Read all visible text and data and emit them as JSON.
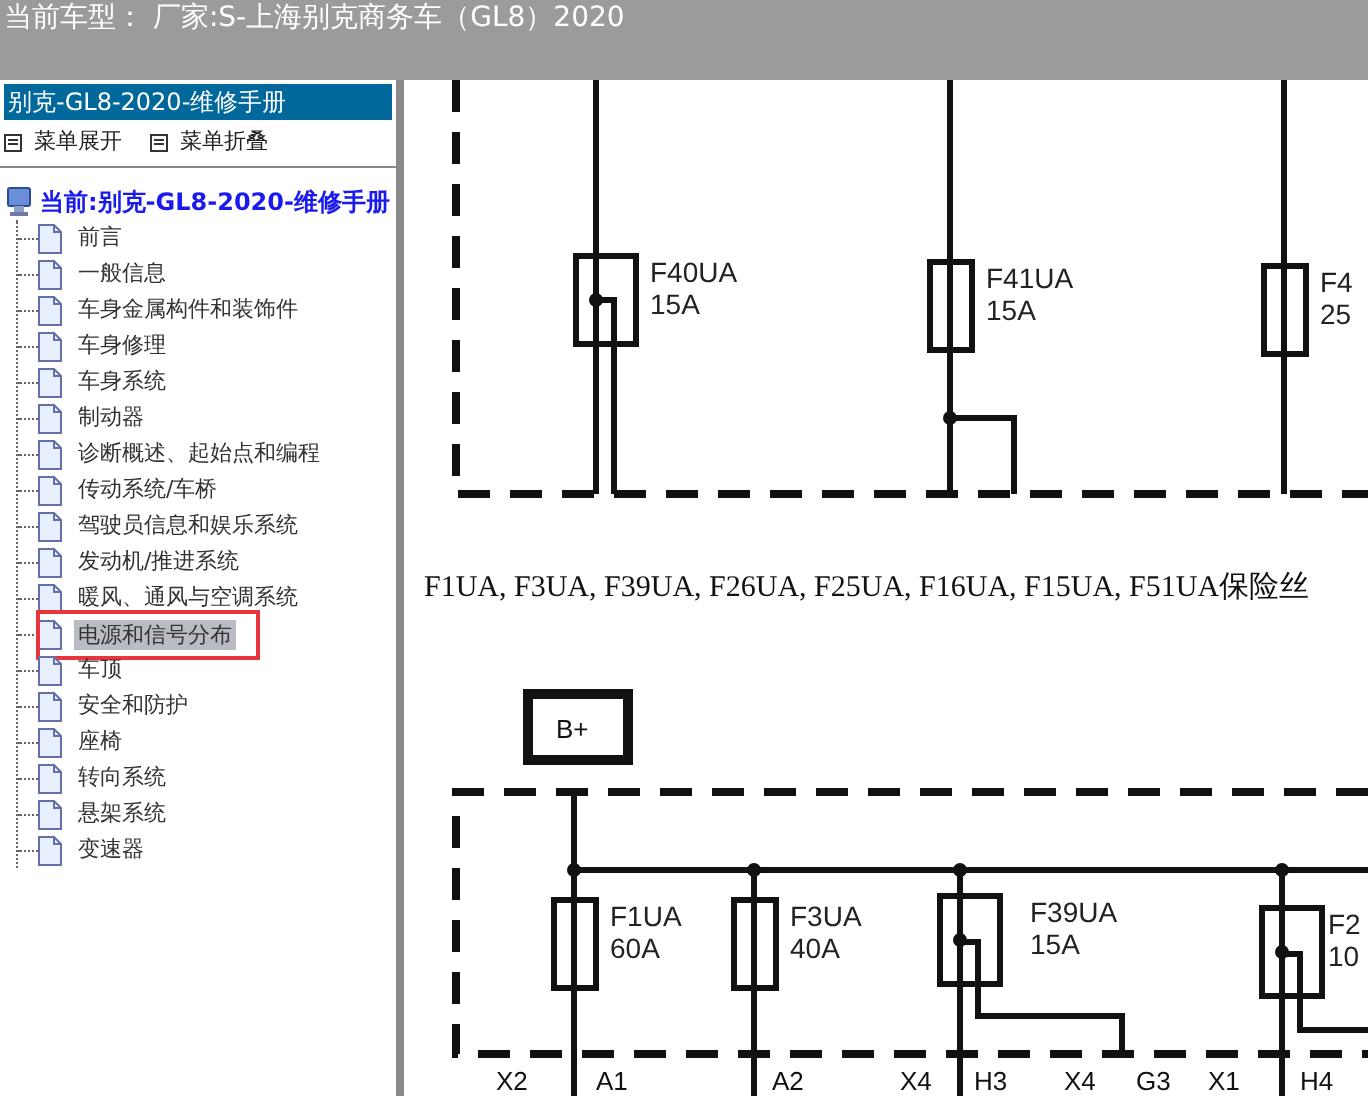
{
  "title_bar": {
    "text": "当前车型： 厂家:S-上海别克商务车（GL8）2020"
  },
  "sidebar": {
    "header": "别克-GL8-2020-维修手册",
    "actions": [
      {
        "label": "菜单展开"
      },
      {
        "label": "菜单折叠"
      }
    ],
    "tree": {
      "label": "当前:别克-GL8-2020-维修手册",
      "children": [
        {
          "label": "前言",
          "selected": false
        },
        {
          "label": "一般信息",
          "selected": false
        },
        {
          "label": "车身金属构件和装饰件",
          "selected": false
        },
        {
          "label": "车身修理",
          "selected": false
        },
        {
          "label": "车身系统",
          "selected": false
        },
        {
          "label": "制动器",
          "selected": false
        },
        {
          "label": "诊断概述、起始点和编程",
          "selected": false
        },
        {
          "label": "传动系统/车桥",
          "selected": false
        },
        {
          "label": "驾驶员信息和娱乐系统",
          "selected": false
        },
        {
          "label": "发动机/推进系统",
          "selected": false
        },
        {
          "label": "暖风、通风与空调系统",
          "selected": false
        },
        {
          "label": "电源和信号分布",
          "selected": true
        },
        {
          "label": "车顶",
          "selected": false
        },
        {
          "label": "安全和防护",
          "selected": false
        },
        {
          "label": "座椅",
          "selected": false
        },
        {
          "label": "转向系统",
          "selected": false
        },
        {
          "label": "悬架系统",
          "selected": false
        },
        {
          "label": "变速器",
          "selected": false
        }
      ]
    }
  },
  "diagram": {
    "upper_fuses": [
      {
        "name": "F40UA",
        "rating": "15A",
        "kind": "tapped"
      },
      {
        "name": "F41UA",
        "rating": "15A",
        "kind": "plain"
      },
      {
        "name": "F4",
        "rating": "25",
        "kind": "plain"
      }
    ],
    "caption": "F1UA, F3UA, F39UA, F26UA, F25UA, F16UA, F15UA, F51UA保险丝",
    "source_label": "B+",
    "lower_fuses": [
      {
        "name": "F1UA",
        "rating": "60A",
        "kind": "plain"
      },
      {
        "name": "F3UA",
        "rating": "40A",
        "kind": "plain"
      },
      {
        "name": "F39UA",
        "rating": "15A",
        "kind": "tapped"
      },
      {
        "name": "F2",
        "rating": "10",
        "kind": "tapped"
      }
    ],
    "connector_labels": [
      "X2",
      "A1",
      "A2",
      "X4",
      "H3",
      "X4",
      "G3",
      "X1",
      "H4"
    ]
  }
}
